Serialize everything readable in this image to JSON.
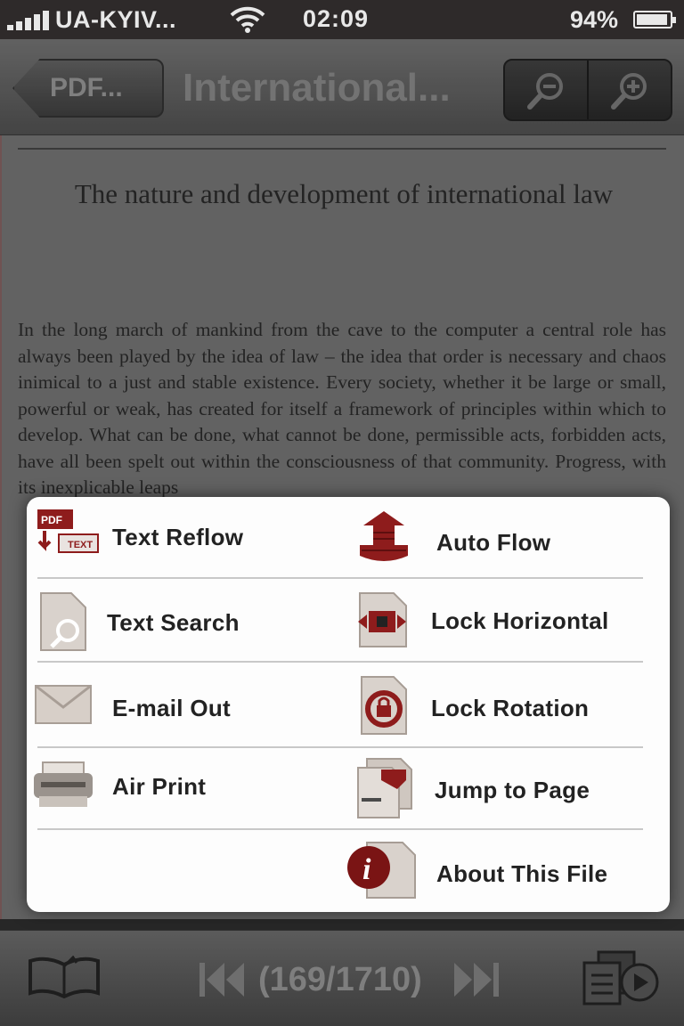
{
  "status_bar": {
    "carrier": "UA-KYIV...",
    "time": "02:09",
    "battery_percent": "94%",
    "battery_level": 0.94
  },
  "navbar": {
    "back_label": "PDF...",
    "title": "International...",
    "zoom_out_icon": "zoom-out-icon",
    "zoom_in_icon": "zoom-in-icon"
  },
  "document": {
    "heading": "The nature and development of international law",
    "body": "In the long march of mankind from the cave to the computer a central role has always been played by the idea of law – the idea that order is necessary and chaos inimical to a just and stable existence. Every society, whether it be large or small, powerful or weak, has created for itself a framework of principles within which to develop. What can be done, what cannot be done, permissible acts, forbidden acts, have all been spelt out within the consciousness of that community. Progress, with its inexplicable leaps"
  },
  "menu": {
    "items": [
      {
        "label": "Text Reflow",
        "icon": "pdf-to-text-icon"
      },
      {
        "label": "Auto Flow",
        "icon": "auto-flow-icon"
      },
      {
        "label": "Text Search",
        "icon": "document-search-icon"
      },
      {
        "label": "Lock Horizontal",
        "icon": "lock-horizontal-icon"
      },
      {
        "label": "E-mail Out",
        "icon": "envelope-icon"
      },
      {
        "label": "Lock Rotation",
        "icon": "lock-rotation-icon"
      },
      {
        "label": "Air Print",
        "icon": "printer-icon"
      },
      {
        "label": "Jump to Page",
        "icon": "jump-page-icon"
      },
      {
        "label": "About This File",
        "icon": "info-icon"
      }
    ]
  },
  "toolbar": {
    "page_indicator": "(169/1710)",
    "bookmarks_icon": "open-book-icon",
    "first_page_icon": "first-page-icon",
    "last_page_icon": "last-page-icon",
    "slideshow_icon": "slideshow-icon"
  },
  "colors": {
    "accent_red": "#8e1c1c",
    "menu_background": "#fdfdfd",
    "bar_grey": "#4a4a4a"
  }
}
